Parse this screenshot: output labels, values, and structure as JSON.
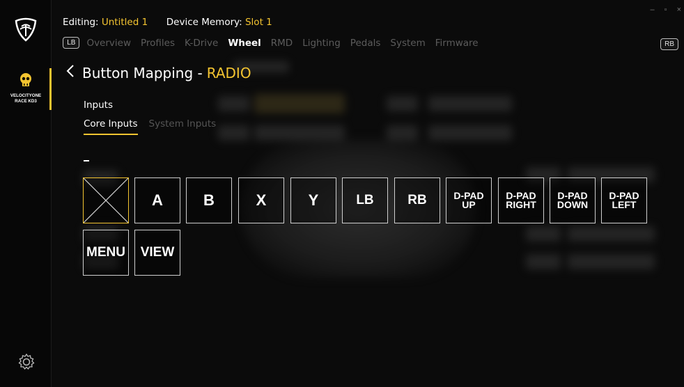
{
  "header": {
    "editing_key": "Editing:",
    "editing_value": "Untitled 1",
    "memory_key": "Device Memory:",
    "memory_value": "Slot 1"
  },
  "window_controls": {
    "minimize": "–",
    "restore": "▫",
    "close": "×"
  },
  "nav": {
    "lb": "LB",
    "rb": "RB",
    "tabs": [
      "Overview",
      "Profiles",
      "K-Drive",
      "Wheel",
      "RMD",
      "Lighting",
      "Pedals",
      "System",
      "Firmware"
    ],
    "active_tab": "Wheel"
  },
  "sidebar": {
    "device_label_line1": "VELOCITYONE",
    "device_label_line2": "RACE KD3"
  },
  "page": {
    "back_glyph": "<",
    "title": "Button Mapping -",
    "title_highlight": "RADIO",
    "section": "Inputs",
    "subtabs": [
      "Core Inputs",
      "System Inputs"
    ],
    "active_subtab": "Core Inputs",
    "current_value": "–"
  },
  "inputs": {
    "row1": [
      "",
      "A",
      "B",
      "X",
      "Y",
      "LB",
      "RB",
      "D-PAD\nUP",
      "D-PAD\nRIGHT",
      "D-PAD\nDOWN",
      "D-PAD\nLEFT"
    ],
    "row2": [
      "MENU",
      "VIEW"
    ]
  },
  "colors": {
    "accent": "#f4c430",
    "background": "#0b0b0b",
    "border": "#cfcfcf"
  },
  "icons": [
    "turtle-beach-logo-icon",
    "skull-device-icon",
    "gear-icon",
    "chevron-left-icon",
    "clear-x-icon"
  ]
}
